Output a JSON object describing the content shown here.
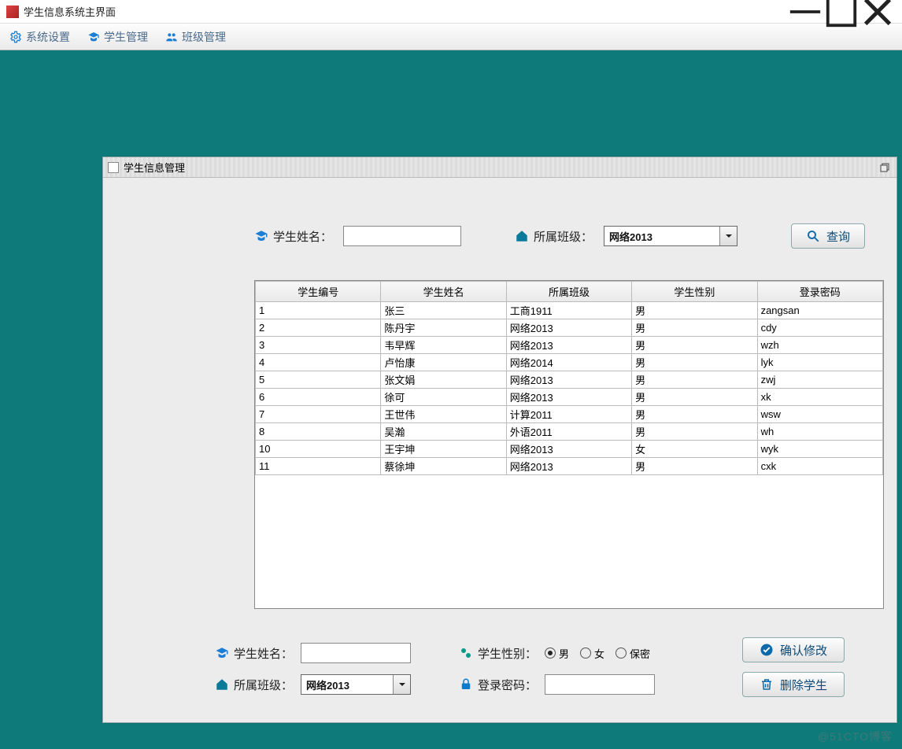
{
  "window": {
    "title": "学生信息系统主界面"
  },
  "menu": {
    "system_settings": "系统设置",
    "student_management": "学生管理",
    "class_management": "班级管理"
  },
  "internal": {
    "title": "学生信息管理"
  },
  "search": {
    "name_label": "学生姓名：",
    "name_value": "",
    "class_label": "所属班级：",
    "class_value": "网络2013",
    "query_btn": "查询"
  },
  "table": {
    "headers": [
      "学生编号",
      "学生姓名",
      "所属班级",
      "学生性别",
      "登录密码"
    ],
    "rows": [
      [
        "1",
        "张三",
        "工商1911",
        "男",
        "zangsan"
      ],
      [
        "2",
        "陈丹宇",
        "网络2013",
        "男",
        "cdy"
      ],
      [
        "3",
        "韦早辉",
        "网络2013",
        "男",
        "wzh"
      ],
      [
        "4",
        "卢怡康",
        "网络2014",
        "男",
        "lyk"
      ],
      [
        "5",
        "张文娟",
        "网络2013",
        "男",
        "zwj"
      ],
      [
        "6",
        "徐可",
        "网络2013",
        "男",
        "xk"
      ],
      [
        "7",
        "王世伟",
        "计算2011",
        "男",
        "wsw"
      ],
      [
        "8",
        "吴瀚",
        "外语2011",
        "男",
        "wh"
      ],
      [
        "10",
        "王宇坤",
        "网络2013",
        "女",
        "wyk"
      ],
      [
        "11",
        "蔡徐坤",
        "网络2013",
        "男",
        "cxk"
      ]
    ]
  },
  "edit": {
    "name_label": "学生姓名：",
    "name_value": "",
    "class_label": "所属班级：",
    "class_value": "网络2013",
    "gender_label": "学生性别：",
    "genders": [
      "男",
      "女",
      "保密"
    ],
    "gender_selected": "男",
    "password_label": "登录密码：",
    "password_value": "",
    "confirm_btn": "确认修改",
    "delete_btn": "删除学生"
  },
  "watermark": "@51CTO博客"
}
